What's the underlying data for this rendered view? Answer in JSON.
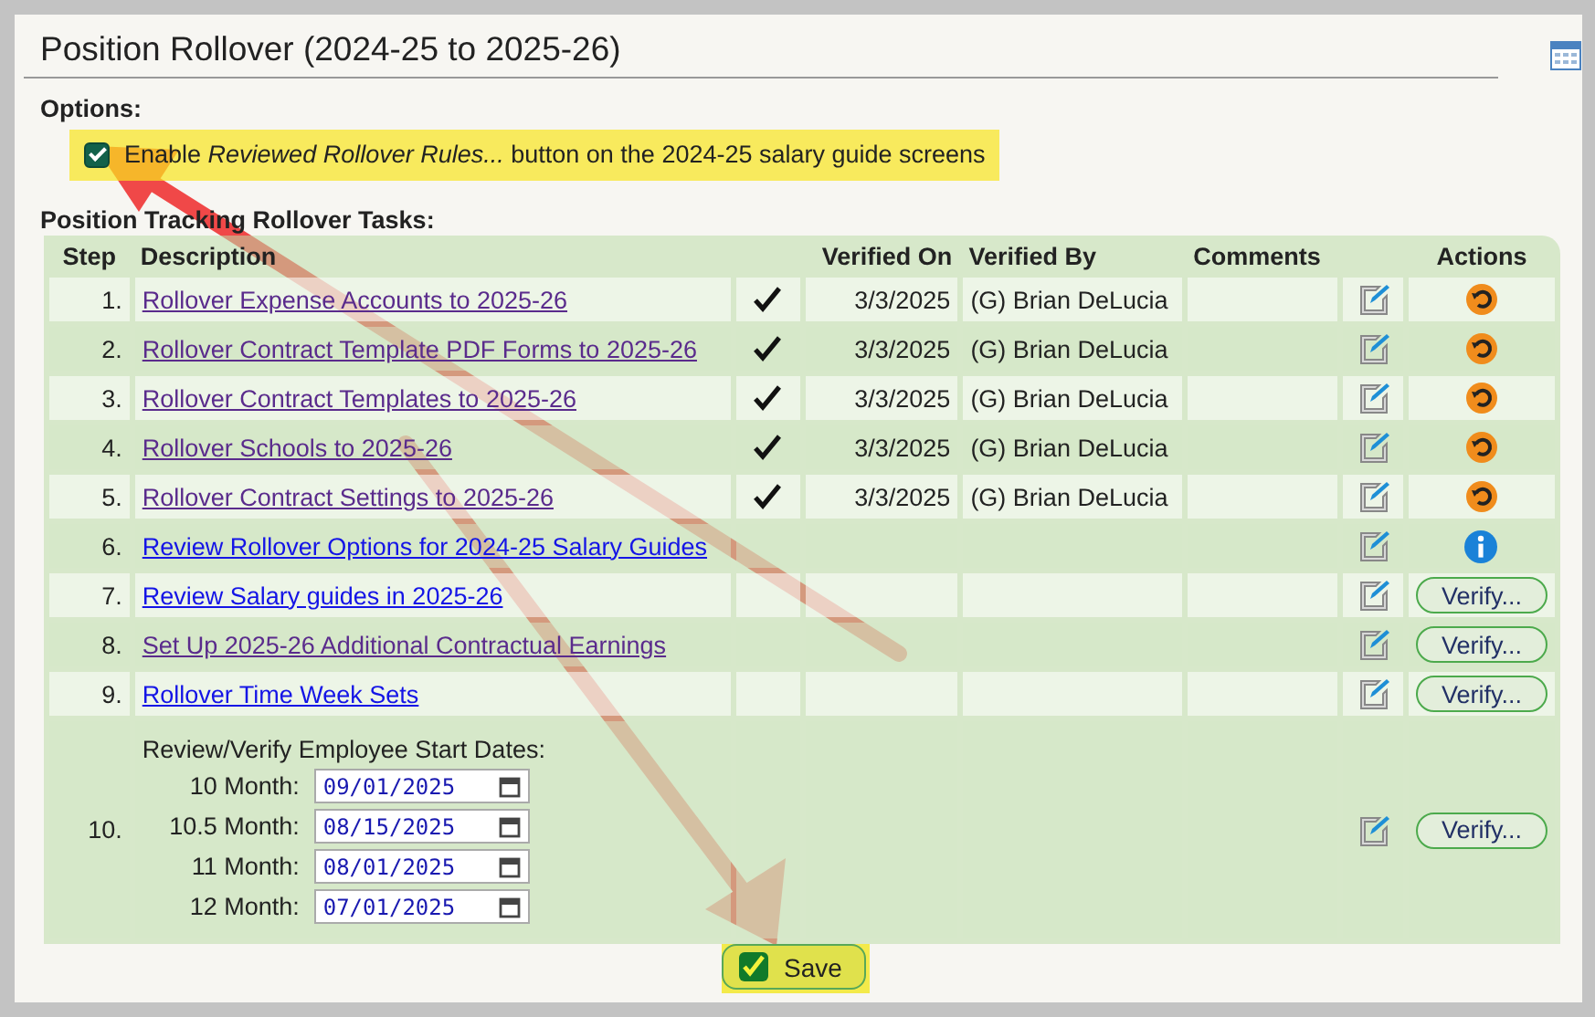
{
  "title": "Position Rollover (2024-25 to 2025-26)",
  "options": {
    "label": "Options:",
    "checkbox": {
      "checked": true,
      "label": "Enable *Reviewed Rollover Rules...* button on the 2024-25 salary guide screens"
    }
  },
  "tasks_label": "Position Tracking Rollover Tasks:",
  "table": {
    "columns": [
      "Step",
      "Description",
      "",
      "Verified On",
      "Verified By",
      "Comments",
      "",
      "Actions"
    ],
    "rows": [
      {
        "step": "1.",
        "description": "Rollover Expense Accounts to 2025-26",
        "visited": true,
        "done": true,
        "verified_on": "3/3/2025",
        "verified_by": "(G) Brian DeLucia",
        "action": {
          "kind": "undo"
        }
      },
      {
        "step": "2.",
        "description": "Rollover Contract Template PDF Forms to 2025-26",
        "visited": true,
        "done": true,
        "verified_on": "3/3/2025",
        "verified_by": "(G) Brian DeLucia",
        "action": {
          "kind": "undo"
        }
      },
      {
        "step": "3.",
        "description": "Rollover Contract Templates to 2025-26",
        "visited": true,
        "done": true,
        "verified_on": "3/3/2025",
        "verified_by": "(G) Brian DeLucia",
        "action": {
          "kind": "undo"
        }
      },
      {
        "step": "4.",
        "description": "Rollover Schools to 2025-26",
        "visited": true,
        "done": true,
        "verified_on": "3/3/2025",
        "verified_by": "(G) Brian DeLucia",
        "action": {
          "kind": "undo"
        }
      },
      {
        "step": "5.",
        "description": "Rollover Contract Settings to 2025-26",
        "visited": true,
        "done": true,
        "verified_on": "3/3/2025",
        "verified_by": "(G) Brian DeLucia",
        "action": {
          "kind": "undo"
        }
      },
      {
        "step": "6.",
        "description": "Review Rollover Options for 2024-25 Salary Guides",
        "visited": false,
        "done": false,
        "action": {
          "kind": "info"
        }
      },
      {
        "step": "7.",
        "description": "Review Salary guides in 2025-26",
        "visited": false,
        "done": false,
        "action": {
          "kind": "verify",
          "label": "Verify..."
        }
      },
      {
        "step": "8.",
        "description": "Set Up 2025-26 Additional Contractual Earnings",
        "visited": true,
        "done": false,
        "action": {
          "kind": "verify",
          "label": "Verify..."
        }
      },
      {
        "step": "9.",
        "description": "Rollover Time Week Sets",
        "visited": false,
        "done": false,
        "action": {
          "kind": "verify",
          "label": "Verify..."
        }
      },
      {
        "step": "10.",
        "kind": "dates",
        "description": "Review/Verify Employee Start Dates:",
        "done": false,
        "dates": [
          {
            "label": "10 Month:",
            "value": "09/01/2025"
          },
          {
            "label": "10.5 Month:",
            "value": "08/15/2025"
          },
          {
            "label": "11 Month:",
            "value": "08/01/2025"
          },
          {
            "label": "12 Month:",
            "value": "07/01/2025"
          }
        ],
        "action": {
          "kind": "verify",
          "label": "Verify..."
        }
      }
    ]
  },
  "save_button": "Save"
}
